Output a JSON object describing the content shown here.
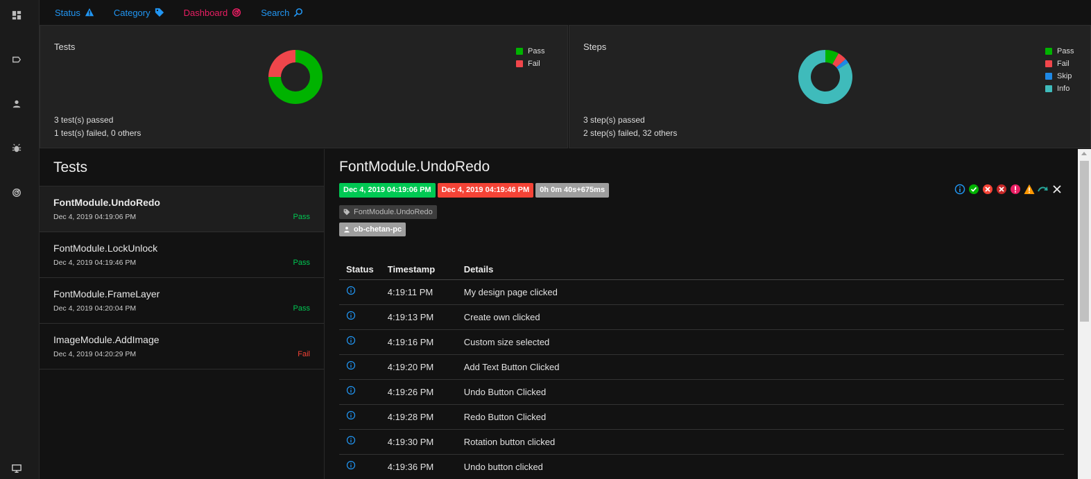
{
  "rail": {
    "items": [
      "dashboard-icon",
      "tag-icon",
      "user-icon",
      "bug-icon",
      "gauge-icon"
    ],
    "bottom": "monitor-icon"
  },
  "nav": [
    {
      "label": "Status",
      "icon": "warning-icon",
      "color": "#2196f3"
    },
    {
      "label": "Category",
      "icon": "tag-icon",
      "color": "#2196f3"
    },
    {
      "label": "Dashboard",
      "icon": "gauge-icon",
      "color": "#e91e63"
    },
    {
      "label": "Search",
      "icon": "search-icon",
      "color": "#2196f3"
    }
  ],
  "tests_card": {
    "title": "Tests",
    "line1": "3 test(s) passed",
    "line2": "1 test(s) failed, 0 others",
    "legend": [
      {
        "label": "Pass",
        "color": "#00b300"
      },
      {
        "label": "Fail",
        "color": "#f0464b"
      }
    ],
    "chart_data": {
      "type": "pie",
      "categories": [
        "Pass",
        "Fail"
      ],
      "values": [
        3,
        1
      ]
    }
  },
  "steps_card": {
    "title": "Steps",
    "line1": "3 step(s) passed",
    "line2": "2 step(s) failed, 32 others",
    "legend": [
      {
        "label": "Pass",
        "color": "#00b300"
      },
      {
        "label": "Fail",
        "color": "#f0464b"
      },
      {
        "label": "Skip",
        "color": "#1e88e5"
      },
      {
        "label": "Info",
        "color": "#3fbbbb"
      }
    ],
    "chart_data": {
      "type": "pie",
      "categories": [
        "Pass",
        "Fail",
        "Skip",
        "Info"
      ],
      "values": [
        3,
        2,
        1,
        31
      ]
    }
  },
  "test_list": {
    "heading": "Tests",
    "items": [
      {
        "name": "FontModule.UndoRedo",
        "date": "Dec 4, 2019 04:19:06 PM",
        "status": "Pass"
      },
      {
        "name": "FontModule.LockUnlock",
        "date": "Dec 4, 2019 04:19:46 PM",
        "status": "Pass"
      },
      {
        "name": "FontModule.FrameLayer",
        "date": "Dec 4, 2019 04:20:04 PM",
        "status": "Pass"
      },
      {
        "name": "ImageModule.AddImage",
        "date": "Dec 4, 2019 04:20:29 PM",
        "status": "Fail"
      }
    ]
  },
  "detail": {
    "title": "FontModule.UndoRedo",
    "start": "Dec 4, 2019 04:19:06 PM",
    "end": "Dec 4, 2019 04:19:46 PM",
    "duration": "0h 0m 40s+675ms",
    "category": "FontModule.UndoRedo",
    "author": "ob-chetan-pc",
    "columns": [
      "Status",
      "Timestamp",
      "Details"
    ],
    "steps": [
      {
        "time": "4:19:11 PM",
        "details": "My design page clicked"
      },
      {
        "time": "4:19:13 PM",
        "details": "Create own clicked"
      },
      {
        "time": "4:19:16 PM",
        "details": "Custom size selected"
      },
      {
        "time": "4:19:20 PM",
        "details": "Add Text Button Clicked"
      },
      {
        "time": "4:19:26 PM",
        "details": "Undo Button Clicked"
      },
      {
        "time": "4:19:28 PM",
        "details": "Redo Button Clicked"
      },
      {
        "time": "4:19:30 PM",
        "details": "Rotation button clicked"
      },
      {
        "time": "4:19:36 PM",
        "details": "Undo button clicked"
      }
    ]
  }
}
